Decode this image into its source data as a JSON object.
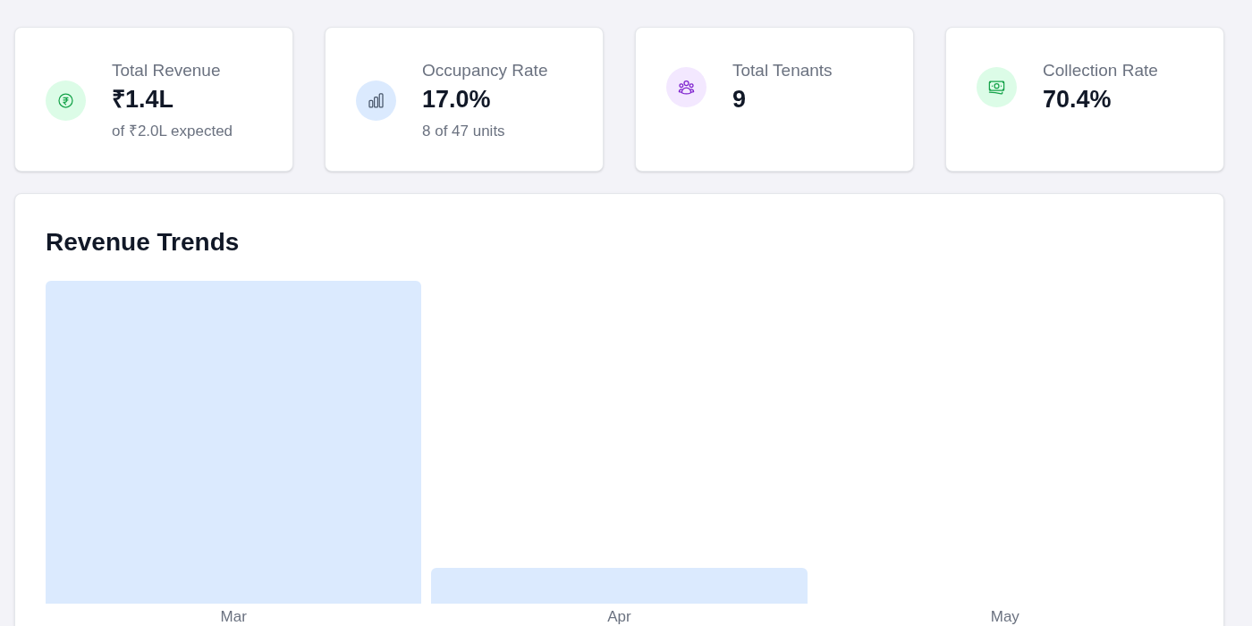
{
  "stats": [
    {
      "kind": "rupee",
      "title": "Total Revenue",
      "value": "₹1.4L",
      "subtitle": "of ₹2.0L expected"
    },
    {
      "kind": "chart",
      "title": "Occupancy Rate",
      "value": "17.0%",
      "subtitle": "8 of 47 units"
    },
    {
      "kind": "people",
      "title": "Total Tenants",
      "value": "9"
    },
    {
      "kind": "cash",
      "title": "Collection Rate",
      "value": "70.4%"
    }
  ],
  "revenue_trends": {
    "title": "Revenue Trends",
    "months": [
      {
        "label": "Mar"
      },
      {
        "label": "Apr"
      },
      {
        "label": "May"
      }
    ]
  }
}
